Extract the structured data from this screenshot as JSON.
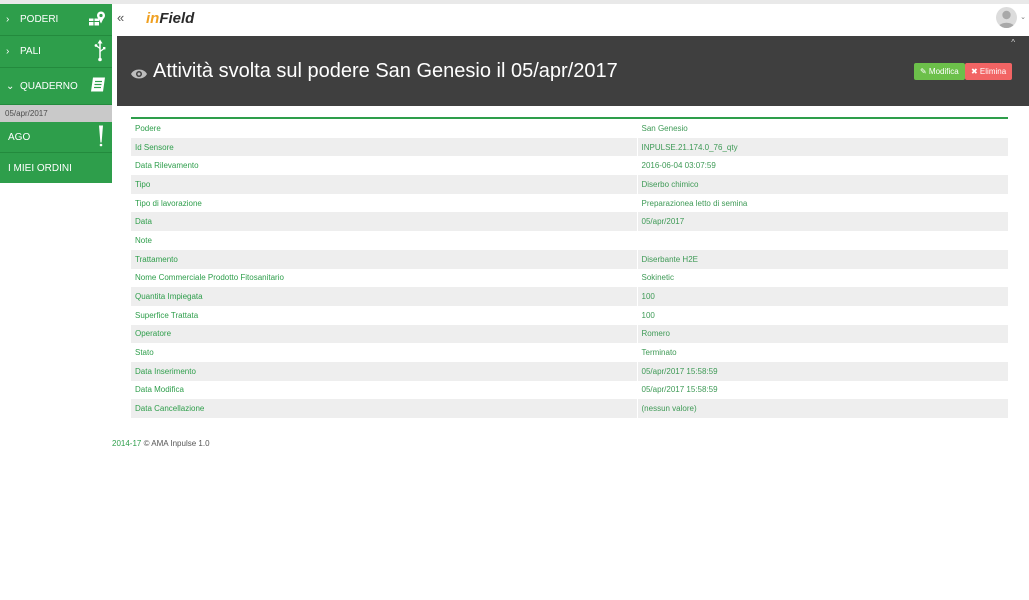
{
  "sidebar": {
    "items": [
      {
        "label": "PODERI",
        "chevron": "›",
        "icon": "map-pin-icon"
      },
      {
        "label": "PALI",
        "chevron": "›",
        "icon": "usb-icon"
      },
      {
        "label": "QUADERNO",
        "chevron": "⌄",
        "icon": "notebook-icon"
      },
      {
        "label": "AGO",
        "icon": "needle-icon"
      },
      {
        "label": "I MIEI ORDINI"
      }
    ],
    "sub_item": "05/apr/2017"
  },
  "header": {
    "collapse": "«",
    "brand_prefix": "in",
    "brand_suffix": "Field",
    "avatar_caret": "⌄"
  },
  "banner": {
    "title": "Attività svolta sul podere San Genesio il 05/apr/2017",
    "edit_label": "✎ Modifica",
    "delete_label": "✖ Elimina",
    "collapse_caret": "^"
  },
  "details": [
    {
      "key": "Podere",
      "value": "San Genesio"
    },
    {
      "key": "Id Sensore",
      "value": "INPULSE.21.174.0_76_qty"
    },
    {
      "key": "Data Rilevamento",
      "value": "2016-06-04 03:07:59"
    },
    {
      "key": "Tipo",
      "value": "Diserbo chimico"
    },
    {
      "key": "Tipo di lavorazione",
      "value": "Preparazionea letto di semina"
    },
    {
      "key": "Data",
      "value": "05/apr/2017"
    },
    {
      "key": "Note",
      "value": ""
    },
    {
      "key": "Trattamento",
      "value": "Diserbante H2E"
    },
    {
      "key": "Nome Commerciale Prodotto Fitosanitario",
      "value": "Sokinetic"
    },
    {
      "key": "Quantita Impiegata",
      "value": "100"
    },
    {
      "key": "Superfice Trattata",
      "value": "100"
    },
    {
      "key": "Operatore",
      "value": "Romero"
    },
    {
      "key": "Stato",
      "value": "Terminato"
    },
    {
      "key": "Data Inserimento",
      "value": "05/apr/2017 15:58:59"
    },
    {
      "key": "Data Modifica",
      "value": "05/apr/2017 15:58:59"
    },
    {
      "key": "Data Cancellazione",
      "value": "(nessun valore)"
    }
  ],
  "footer": {
    "years": "2014-17",
    "text": "© AMA Inpulse 1.0"
  },
  "colors": {
    "sidebar_green": "#2e9e4b",
    "banner_dark": "#3f3f3f",
    "edit_green": "#6cc04a",
    "delete_red": "#f26464",
    "brand_orange": "#f0a020"
  }
}
